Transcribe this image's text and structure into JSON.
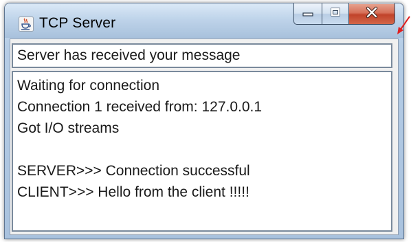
{
  "window": {
    "title": "TCP Server",
    "app_icon": "java-coffee-cup-icon",
    "buttons": {
      "minimize_icon": "minimize-icon",
      "maximize_icon": "maximize-icon",
      "close_icon": "close-icon"
    }
  },
  "input": {
    "value": "Server has received your message"
  },
  "log": {
    "lines": [
      "Waiting for connection",
      "Connection 1 received from: 127.0.0.1",
      "Got I/O streams",
      "",
      "SERVER>>> Connection successful",
      "CLIENT>>> Hello from the client !!!!!"
    ]
  },
  "colors": {
    "close_button": "#c1432a",
    "annotation_arrow": "#e02020"
  }
}
